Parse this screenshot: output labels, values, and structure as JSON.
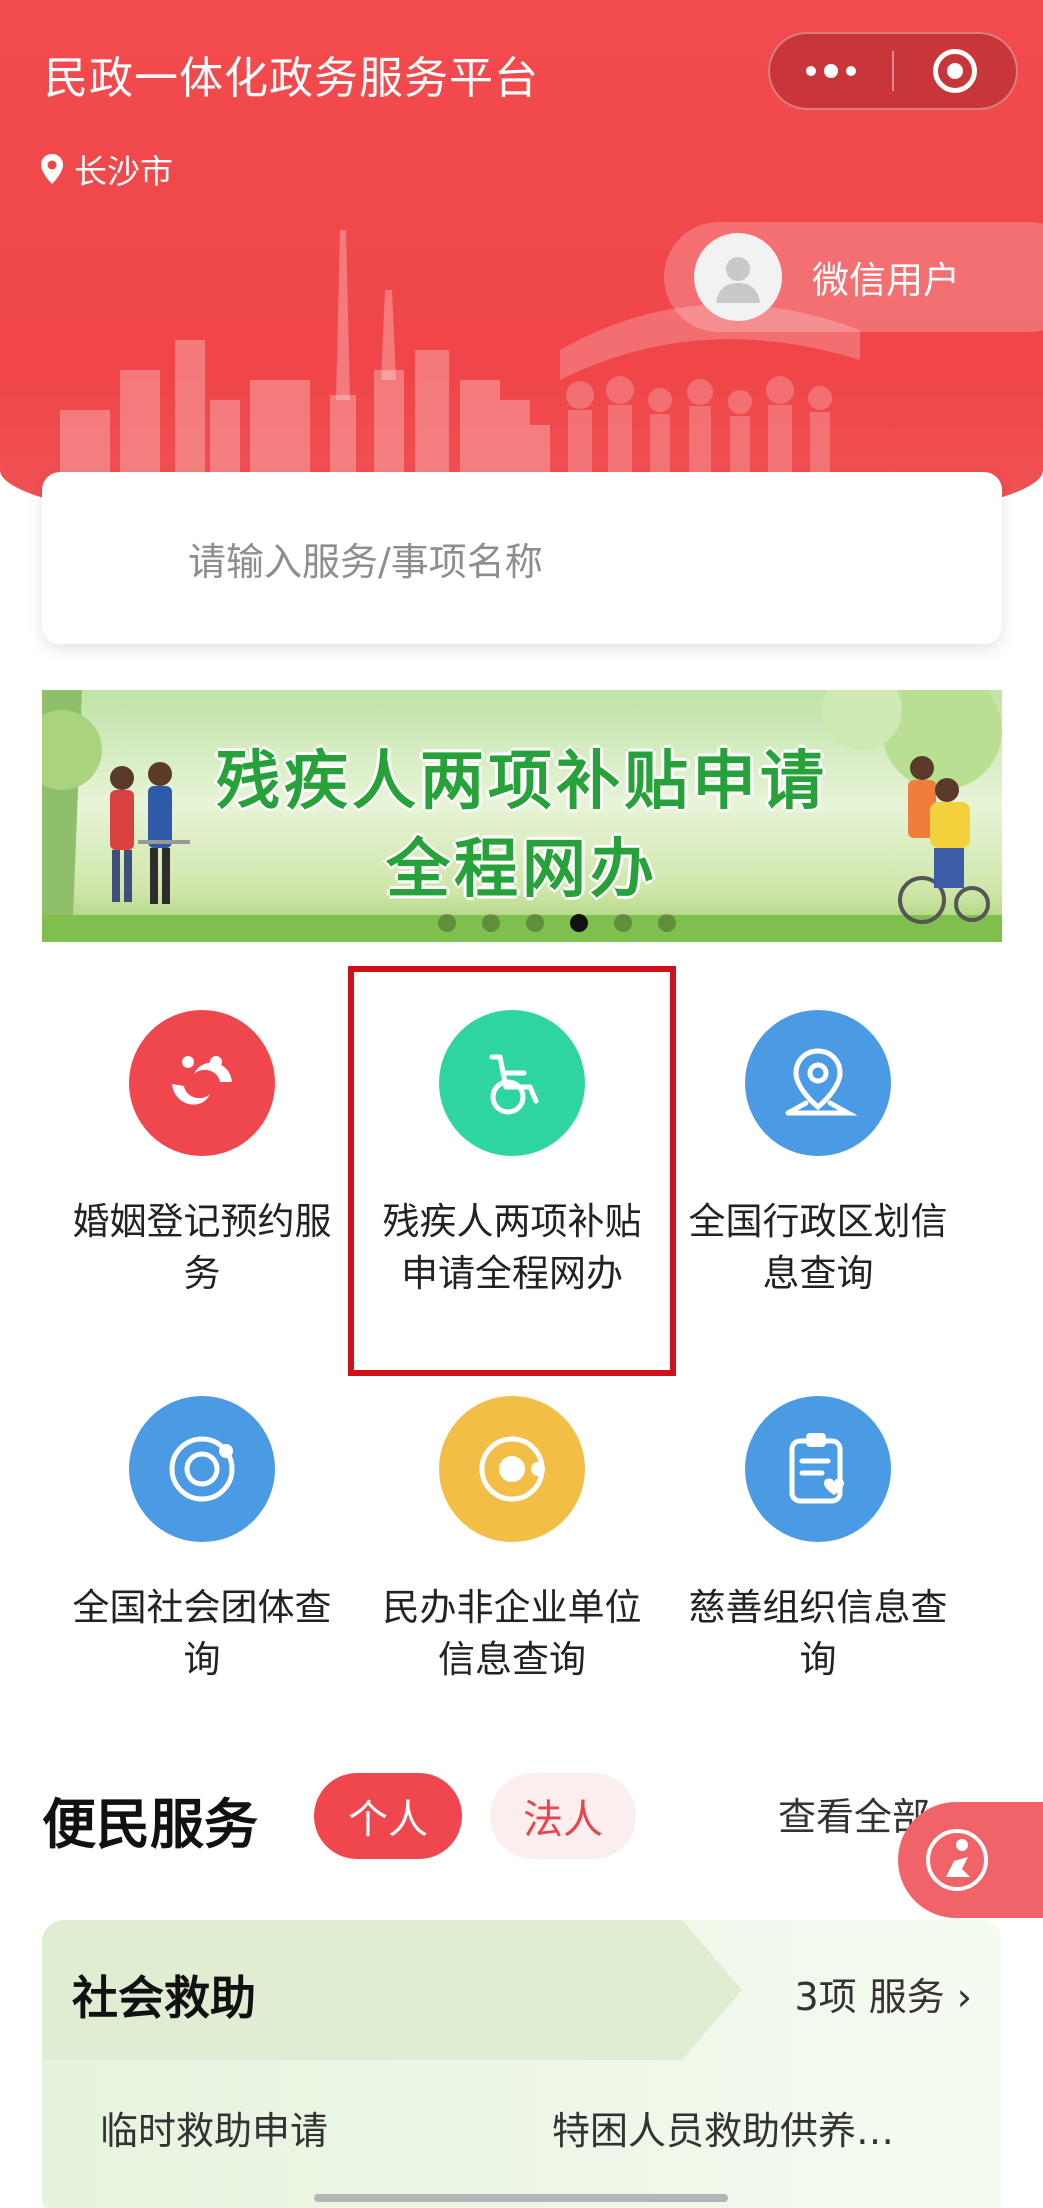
{
  "header": {
    "app_title": "民政一体化政务服务平台",
    "location": "长沙市",
    "user_name": "微信用户",
    "accent_color": "#f04649"
  },
  "search": {
    "placeholder": "请输入服务/事项名称"
  },
  "banner": {
    "line1": "残疾人两项补贴申请",
    "line2": "全程网办",
    "active_slide": 4,
    "slide_count": 6
  },
  "services": [
    {
      "label": "婚姻登记预约服务",
      "icon": "marriage-icon",
      "color": "#f0464d"
    },
    {
      "label": "残疾人两项补贴申请全程网办",
      "icon": "wheelchair-icon",
      "color": "#2fd5a0"
    },
    {
      "label": "全国行政区划信息查询",
      "icon": "map-pin-icon",
      "color": "#4a9be4"
    },
    {
      "label": "全国社会团体查询",
      "icon": "orbit-icon",
      "color": "#4a9be4"
    },
    {
      "label": "民办非企业单位信息查询",
      "icon": "orbit-icon",
      "color": "#f2be46"
    },
    {
      "label": "慈善组织信息查询",
      "icon": "clipboard-heart-icon",
      "color": "#4a9be4"
    }
  ],
  "bianmin": {
    "title": "便民服务",
    "tab_personal": "个人",
    "tab_legal": "法人",
    "view_all": "查看全部"
  },
  "card": {
    "title": "社会救助",
    "count": "3项 服务 ›",
    "items": [
      "临时救助申请",
      "特困人员救助供养…"
    ]
  }
}
